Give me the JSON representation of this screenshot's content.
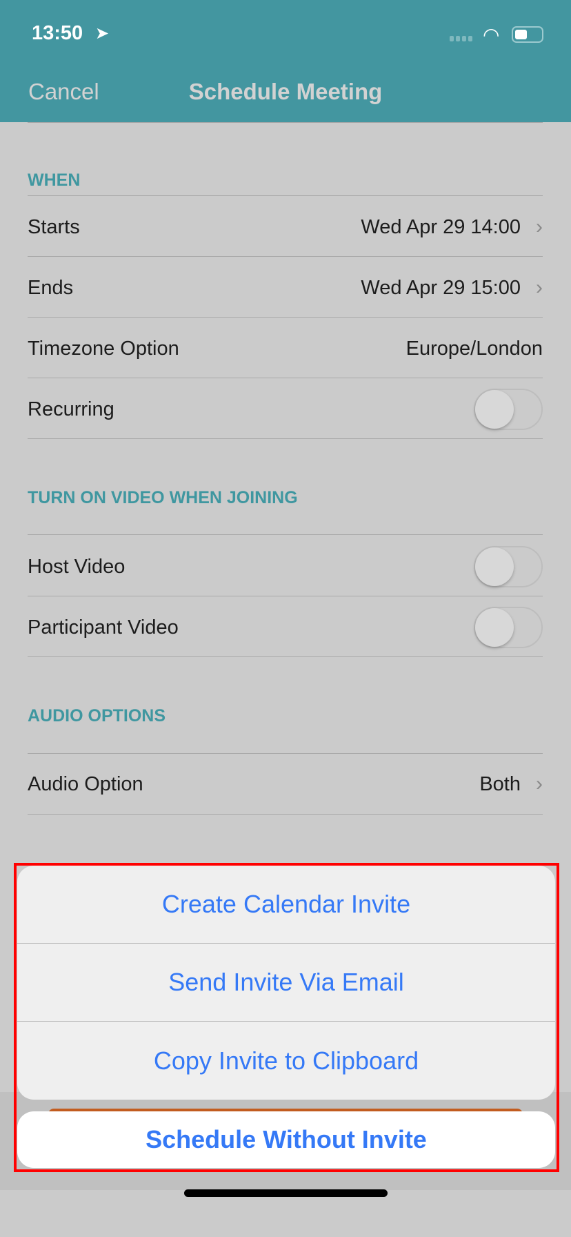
{
  "status_bar": {
    "time": "13:50",
    "location_icon": "location-arrow-icon",
    "wifi_icon": "wifi-icon",
    "battery_icon": "battery-icon"
  },
  "nav": {
    "cancel": "Cancel",
    "title": "Schedule Meeting",
    "color": "#4396a0"
  },
  "when": {
    "header": "WHEN",
    "starts_label": "Starts",
    "starts_value": "Wed Apr 29 14:00",
    "ends_label": "Ends",
    "ends_value": "Wed Apr 29 15:00",
    "timezone_label": "Timezone Option",
    "timezone_value": "Europe/London",
    "recurring_label": "Recurring",
    "recurring_on": false
  },
  "video": {
    "header": "TURN ON VIDEO WHEN JOINING",
    "host_label": "Host Video",
    "host_on": false,
    "participant_label": "Participant Video",
    "participant_on": false
  },
  "audio": {
    "header": "AUDIO OPTIONS",
    "option_label": "Audio Option",
    "option_value": "Both"
  },
  "action_sheet": {
    "options": [
      "Create Calendar Invite",
      "Send Invite Via Email",
      "Copy Invite to Clipboard"
    ],
    "cancel": "Schedule Without Invite",
    "accent": "#3579f6"
  }
}
